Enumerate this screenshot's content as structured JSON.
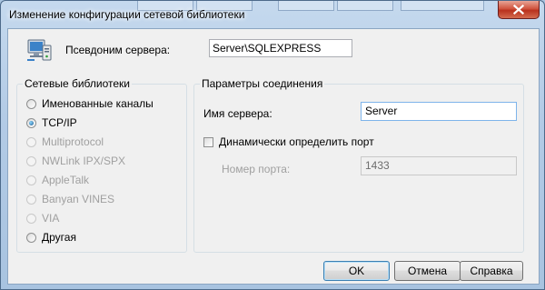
{
  "window": {
    "title": "Изменение конфигурации сетевой библиотеки"
  },
  "alias": {
    "label": "Псевдоним сервера:",
    "value": "Server\\SQLEXPRESS"
  },
  "network_libraries": {
    "caption": "Сетевые библиотеки",
    "options": [
      {
        "label": "Именованные каналы",
        "selected": false,
        "enabled": true
      },
      {
        "label": "TCP/IP",
        "selected": true,
        "enabled": true
      },
      {
        "label": "Multiprotocol",
        "selected": false,
        "enabled": false
      },
      {
        "label": "NWLink IPX/SPX",
        "selected": false,
        "enabled": false
      },
      {
        "label": "AppleTalk",
        "selected": false,
        "enabled": false
      },
      {
        "label": "Banyan VINES",
        "selected": false,
        "enabled": false
      },
      {
        "label": "VIA",
        "selected": false,
        "enabled": false
      },
      {
        "label": "Другая",
        "selected": false,
        "enabled": true
      }
    ]
  },
  "connection": {
    "caption": "Параметры соединения",
    "server_name_label": "Имя сервера:",
    "server_name_value": "Server",
    "dynamic_port_label": "Динамически определить порт",
    "dynamic_port_checked": false,
    "port_label": "Номер порта:",
    "port_value": "1433"
  },
  "buttons": {
    "ok": "OK",
    "cancel": "Отмена",
    "help": "Справка"
  },
  "colors": {
    "title_glass": "#b3cbe6",
    "close_button": "#c7432c",
    "dialog_background": "#f0f0f0"
  },
  "icons": [
    "server-network-icon",
    "close-icon"
  ]
}
